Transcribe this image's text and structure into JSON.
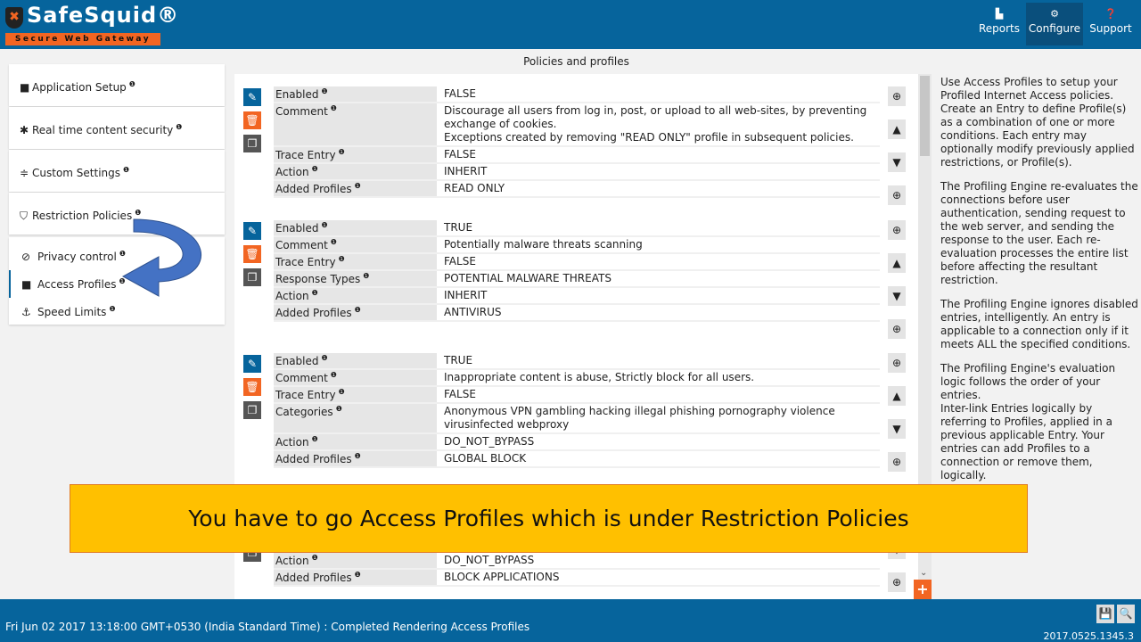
{
  "header": {
    "brand": "SafeSquid®",
    "tagline": "Secure Web Gateway",
    "nav": [
      {
        "label": "Reports",
        "icon": "chart-icon"
      },
      {
        "label": "Configure",
        "icon": "gears-icon",
        "active": true
      },
      {
        "label": "Support",
        "icon": "question-icon"
      }
    ]
  },
  "sidebar": {
    "items": [
      {
        "label": "Application Setup",
        "icon": "briefcase-icon"
      },
      {
        "label": "Real time content security",
        "icon": "bug-icon"
      },
      {
        "label": "Custom Settings",
        "icon": "sliders-icon"
      },
      {
        "label": "Restriction Policies",
        "icon": "shield-icon"
      }
    ],
    "subitems": [
      {
        "label": "Privacy control",
        "icon": "ban-icon"
      },
      {
        "label": "Access Profiles",
        "icon": "briefcase-icon",
        "active": true
      },
      {
        "label": "Speed Limits",
        "icon": "anchor-icon"
      }
    ]
  },
  "main": {
    "title": "Policies and profiles",
    "entries": [
      {
        "rows": [
          [
            "Enabled",
            "FALSE"
          ],
          [
            "Comment",
            "Discourage all users from log in, post, or upload to all web-sites, by preventing exchange of cookies.\nExceptions created by removing \"READ ONLY\" profile in subsequent policies."
          ],
          [
            "Trace Entry",
            "FALSE"
          ],
          [
            "Action",
            "INHERIT"
          ],
          [
            "Added Profiles",
            "READ ONLY"
          ]
        ]
      },
      {
        "rows": [
          [
            "Enabled",
            "TRUE"
          ],
          [
            "Comment",
            "Potentially malware threats scanning"
          ],
          [
            "Trace Entry",
            "FALSE"
          ],
          [
            "Response Types",
            "POTENTIAL MALWARE THREATS"
          ],
          [
            "Action",
            "INHERIT"
          ],
          [
            "Added Profiles",
            "ANTIVIRUS"
          ]
        ]
      },
      {
        "rows": [
          [
            "Enabled",
            "TRUE"
          ],
          [
            "Comment",
            "Inappropriate content is abuse, Strictly block for all users."
          ],
          [
            "Trace Entry",
            "FALSE"
          ],
          [
            "Categories",
            "Anonymous VPN  gambling  hacking  illegal  phishing  pornography  violence\nvirusinfected  webproxy"
          ],
          [
            "Action",
            "DO_NOT_BYPASS"
          ],
          [
            "Added Profiles",
            "GLOBAL BLOCK"
          ]
        ]
      },
      {
        "rows": [
          [
            "Action",
            "DO_NOT_BYPASS"
          ],
          [
            "Added Profiles",
            "BLOCK APPLICATIONS"
          ]
        ]
      }
    ]
  },
  "help": [
    "Use Access Profiles to setup your Profiled Internet Access policies. Create an Entry to define Profile(s) as a combination of one or more conditions. Each entry may optionally modify previously applied restrictions, or Profile(s).",
    "The Profiling Engine re-evaluates the connections before user authentication, sending request to the web server, and sending the response to the user. Each re-evaluation processes the entire list before affecting the resultant restriction.",
    "The Profiling Engine ignores disabled entries, intelligently. An entry is applicable to a connection only if it meets ALL the specified conditions.",
    "The Profiling Engine's evaluation logic follows the order of your entries.\nInter-link Entries logically by referring to Profiles, applied in a previous applicable Entry. Your entries can add Profiles to a connection or remove them, logically."
  ],
  "footer": {
    "status": "Fri Jun 02 2017 13:18:00 GMT+0530 (India Standard Time) : Completed Rendering Access Profiles",
    "version": "2017.0525.1345.3"
  },
  "banner": {
    "text": "You have to go Access Profiles which is under Restriction Policies"
  },
  "colors": {
    "brand": "#06649c",
    "accent": "#f26522",
    "banner": "#ffc000"
  }
}
